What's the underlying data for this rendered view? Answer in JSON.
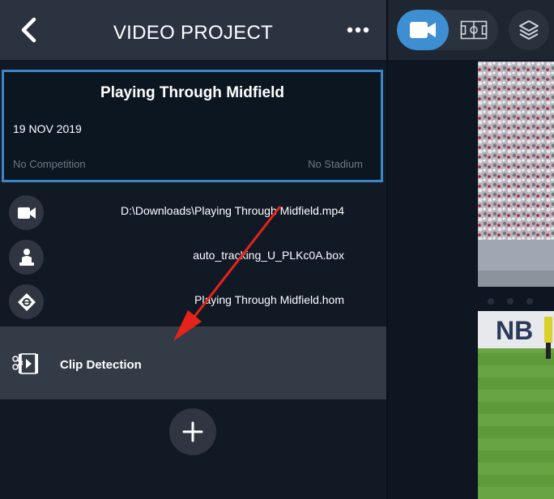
{
  "header": {
    "title": "VIDEO PROJECT"
  },
  "project": {
    "title": "Playing Through Midfield",
    "date": "19 NOV 2019",
    "competition": "No Competition",
    "stadium": "No Stadium"
  },
  "files": [
    {
      "icon": "video-camera-icon",
      "path": "D:\\Downloads\\Playing Through Midfield.mp4"
    },
    {
      "icon": "player-tracking-icon",
      "path": "auto_tracking_U_PLKc0A.box"
    },
    {
      "icon": "pitch-homography-icon",
      "path": "Playing Through Midfield.hom"
    }
  ],
  "clip_detection": {
    "label": "Clip Detection",
    "icon": "clip-detection-icon"
  },
  "view_toggle": {
    "options": [
      "video-camera-icon",
      "pitch-icon"
    ],
    "selected": "video-camera-icon"
  },
  "video_overlay": {
    "sponsor_text": "NB"
  },
  "colors": {
    "accent": "#3d8fd1",
    "card_border": "#3d86c6",
    "arrow": "#e5231b",
    "panel_bg": "#111925",
    "header_bg": "#2b3340"
  }
}
